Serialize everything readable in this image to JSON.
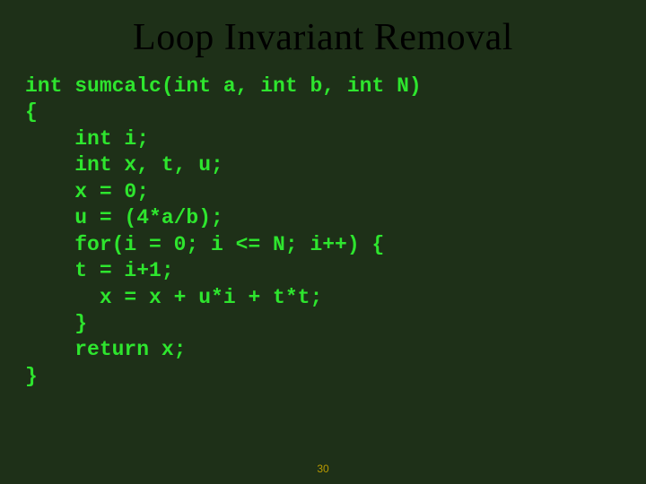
{
  "slide": {
    "title": "Loop Invariant Removal",
    "code": "int sumcalc(int a, int b, int N)\n{\n    int i;\n    int x, t, u;\n    x = 0;\n    u = (4*a/b);\n    for(i = 0; i <= N; i++) {\n    t = i+1;\n      x = x + u*i + t*t;\n    }\n    return x;\n}",
    "page_number": "30"
  }
}
